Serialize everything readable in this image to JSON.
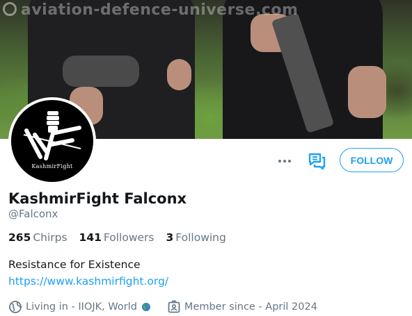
{
  "banner": {
    "watermark": "aviation-defence-universe.com"
  },
  "avatar": {
    "caption": "KashmirFight"
  },
  "actions": {
    "more_icon": "more-dots-icon",
    "message_icon": "message-icon",
    "follow_label": "FOLLOW"
  },
  "profile": {
    "display_name": "KashmirFight Falconx",
    "handle": "@Falconx",
    "bio": "Resistance for Existence",
    "link": "https://www.kashmirfight.org/"
  },
  "stats": [
    {
      "count": "265",
      "label": "Chirps"
    },
    {
      "count": "141",
      "label": "Followers"
    },
    {
      "count": "3",
      "label": "Following"
    }
  ],
  "meta": {
    "location": "Living in - IIOJK, World",
    "joined": "Member since - April 2024"
  },
  "colors": {
    "accent": "#1da1f2",
    "secondary_text": "#657786"
  }
}
